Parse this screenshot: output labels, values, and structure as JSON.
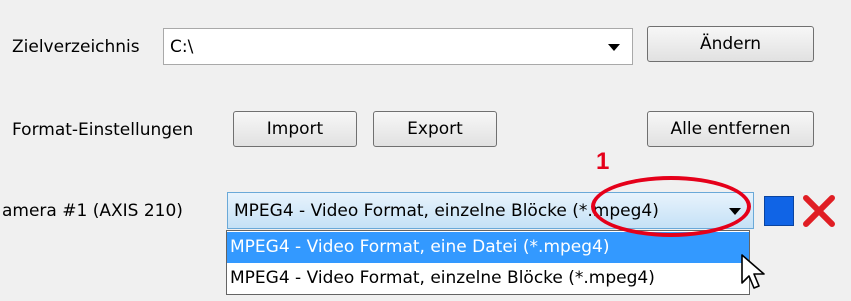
{
  "row1": {
    "label": "Zielverzeichnis",
    "path_value": "C:\\",
    "change_button": "Ändern"
  },
  "row2": {
    "label": "Format-Einstellungen",
    "import_button": "Import",
    "export_button": "Export",
    "remove_all_button": "Alle entfernen"
  },
  "row3": {
    "label": "amera #1 (AXIS 210)",
    "format_value": "MPEG4 - Video Format, einzelne Blöcke (*.mpeg4)",
    "color_swatch": "#1064e6",
    "delete_color": "#e01e24"
  },
  "dropdown": {
    "options": [
      "MPEG4 - Video Format, eine Datei (*.mpeg4)",
      "MPEG4 - Video Format, einzelne Blöcke (*.mpeg4)"
    ],
    "highlighted_index": 0
  },
  "annotation": {
    "marker": "1",
    "color": "#e5001a"
  },
  "icons": {
    "delete": "close-x-icon",
    "color": "color-swatch-icon",
    "cursor": "mouse-pointer-icon",
    "dropdown_arrow": "chevron-down-icon"
  }
}
